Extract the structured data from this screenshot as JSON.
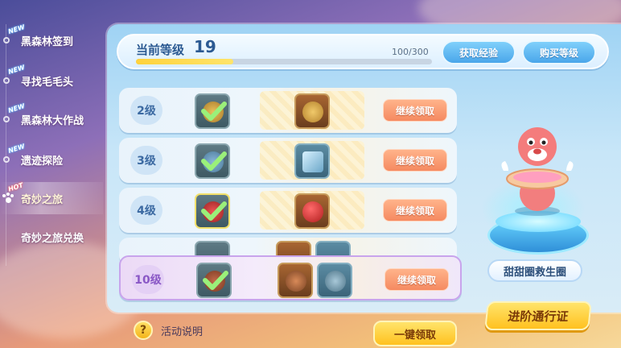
{
  "nav": {
    "items": [
      {
        "label": "黑森林签到",
        "badge": "NEW"
      },
      {
        "label": "寻找毛毛头",
        "badge": "NEW"
      },
      {
        "label": "黑森林大作战",
        "badge": "NEW"
      },
      {
        "label": "遗迹探险",
        "badge": "NEW"
      },
      {
        "label": "奇妙之旅",
        "badge": "HOT"
      },
      {
        "label": "奇妙之旅兑换",
        "badge": ""
      }
    ]
  },
  "level": {
    "label": "当前等级",
    "value": "19",
    "progress_text": "100/300",
    "progress_fraction": 0.33,
    "get_exp_label": "获取经验",
    "buy_level_label": "购买等级"
  },
  "rows": [
    {
      "level": "2级",
      "claim_label": "继续领取"
    },
    {
      "level": "3级",
      "claim_label": "继续领取"
    },
    {
      "level": "4级",
      "claim_label": "继续领取"
    },
    {
      "level": "10级",
      "claim_label": "继续领取"
    }
  ],
  "character": {
    "name": "甜甜圈救生圈"
  },
  "advanced_pass_label": "进阶通行证",
  "help": {
    "icon": "?",
    "label": "活动说明"
  },
  "onekey_label": "一键领取",
  "colors": {
    "claim": "#f58a61",
    "gold_button": "#ffc11f",
    "blue_button": "#4aa6ea"
  }
}
